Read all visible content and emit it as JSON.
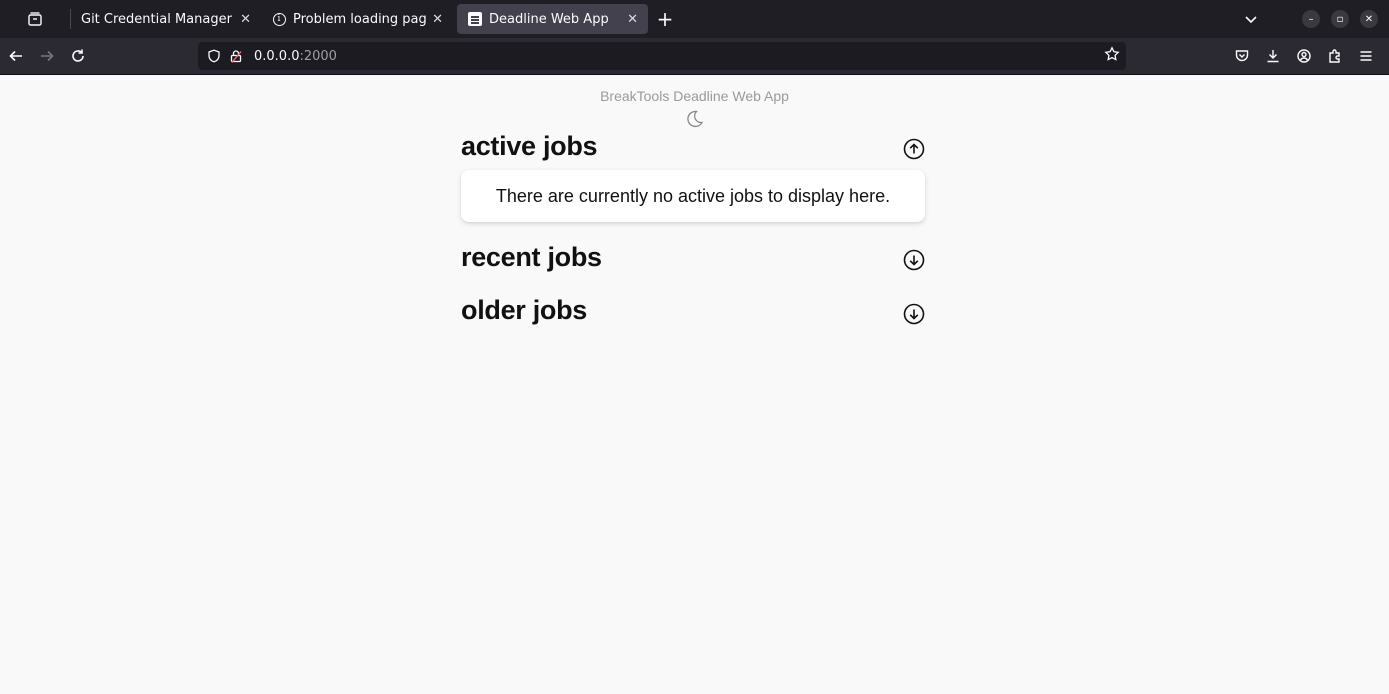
{
  "browser": {
    "tabs": [
      {
        "title": "Git Credential Manager - Aut",
        "icon": "git-favicon"
      },
      {
        "title": "Problem loading page",
        "icon": "info-icon"
      },
      {
        "title": "Deadline Web App",
        "icon": "page-favicon",
        "active": true
      }
    ],
    "url": {
      "host": "0.0.0.0",
      "port": ":2000"
    }
  },
  "app": {
    "title": "BreakTools Deadline Web App",
    "theme_icon": "moon-icon"
  },
  "sections": {
    "active": {
      "heading": "active jobs",
      "toggle_icon": "arrow-up-circle-icon",
      "expanded": true,
      "empty_message": "There are currently no active jobs to display here."
    },
    "recent": {
      "heading": "recent jobs",
      "toggle_icon": "arrow-down-circle-icon",
      "expanded": false
    },
    "older": {
      "heading": "older jobs",
      "toggle_icon": "arrow-down-circle-icon",
      "expanded": false
    }
  }
}
